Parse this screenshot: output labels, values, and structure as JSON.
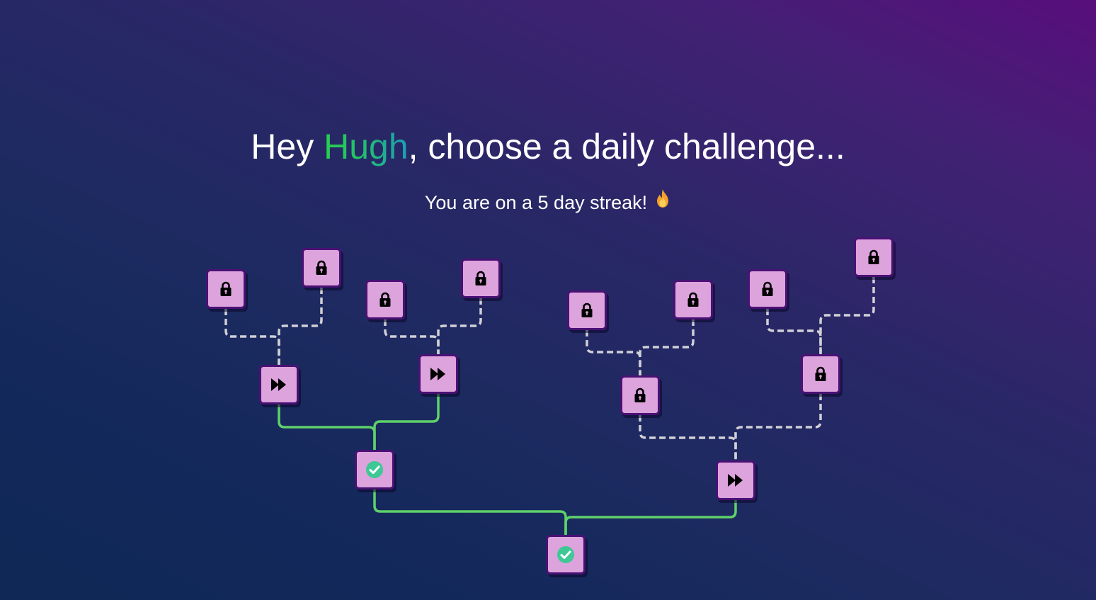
{
  "header": {
    "greeting": "Hey",
    "user_name": "Hugh",
    "prompt": ", choose a daily challenge..."
  },
  "streak": {
    "text": "You are on a 5 day streak!",
    "icon": "flame-icon"
  },
  "colors": {
    "node_fill": "#dca3dc",
    "node_border": "#4a1175",
    "completed_path": "#5fd16a",
    "locked_path": "#d0d0d6",
    "check_badge": "#3ec896"
  },
  "challenge_tree": {
    "nodes": [
      {
        "id": "n1",
        "state": "locked",
        "icon": "lock-icon"
      },
      {
        "id": "n2",
        "state": "locked",
        "icon": "lock-icon"
      },
      {
        "id": "n3",
        "state": "locked",
        "icon": "lock-icon"
      },
      {
        "id": "n4",
        "state": "locked",
        "icon": "lock-icon"
      },
      {
        "id": "n5",
        "state": "available",
        "icon": "fast-forward-icon"
      },
      {
        "id": "n6",
        "state": "available",
        "icon": "fast-forward-icon"
      },
      {
        "id": "n7",
        "state": "completed",
        "icon": "check-circle-icon"
      },
      {
        "id": "n8",
        "state": "locked",
        "icon": "lock-icon"
      },
      {
        "id": "n9",
        "state": "locked",
        "icon": "lock-icon"
      },
      {
        "id": "n10",
        "state": "locked",
        "icon": "lock-icon"
      },
      {
        "id": "n11",
        "state": "locked",
        "icon": "lock-icon"
      },
      {
        "id": "n12",
        "state": "locked",
        "icon": "lock-icon"
      },
      {
        "id": "n13",
        "state": "locked",
        "icon": "lock-icon"
      },
      {
        "id": "n14",
        "state": "available",
        "icon": "fast-forward-icon"
      },
      {
        "id": "n15",
        "state": "completed",
        "icon": "check-circle-icon"
      }
    ],
    "edges": [
      {
        "from": "n1",
        "to": "n5",
        "state": "locked"
      },
      {
        "from": "n2",
        "to": "n5",
        "state": "locked"
      },
      {
        "from": "n3",
        "to": "n6",
        "state": "locked"
      },
      {
        "from": "n4",
        "to": "n6",
        "state": "locked"
      },
      {
        "from": "n5",
        "to": "n7",
        "state": "completed"
      },
      {
        "from": "n6",
        "to": "n7",
        "state": "completed"
      },
      {
        "from": "n8",
        "to": "n12",
        "state": "locked"
      },
      {
        "from": "n9",
        "to": "n12",
        "state": "locked"
      },
      {
        "from": "n10",
        "to": "n13",
        "state": "locked"
      },
      {
        "from": "n11",
        "to": "n13",
        "state": "locked"
      },
      {
        "from": "n12",
        "to": "n14",
        "state": "locked"
      },
      {
        "from": "n13",
        "to": "n14",
        "state": "locked"
      },
      {
        "from": "n7",
        "to": "n15",
        "state": "completed"
      },
      {
        "from": "n14",
        "to": "n15",
        "state": "completed"
      }
    ]
  }
}
